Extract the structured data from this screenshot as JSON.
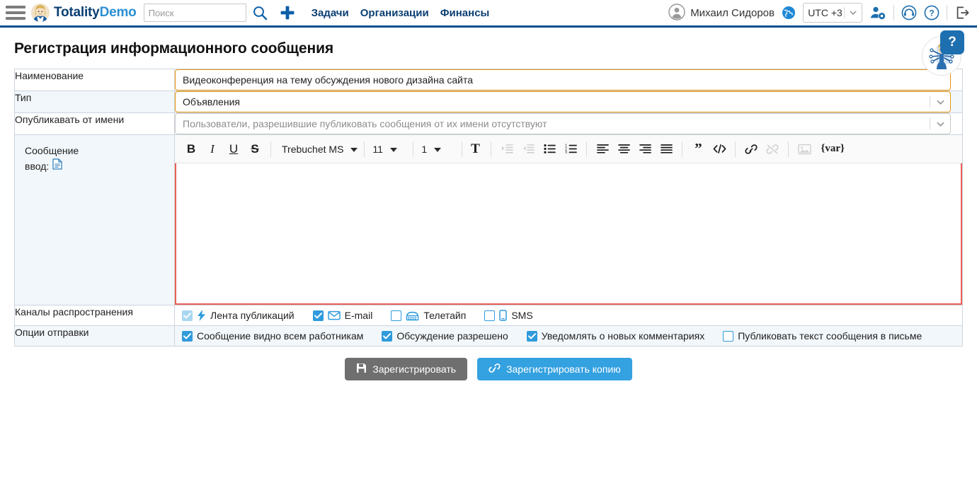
{
  "header": {
    "menu_icon": "hamburger-icon",
    "brand": {
      "part1": "Totality",
      "part2": "Demo"
    },
    "search": {
      "value": "",
      "placeholder": "Поиск"
    },
    "search_icon": "search-icon",
    "add_icon": "plus-icon",
    "nav": [
      {
        "label": "Задачи"
      },
      {
        "label": "Организации"
      },
      {
        "label": "Финансы"
      }
    ],
    "user": {
      "name": "Михаил Сидоров",
      "avatar_icon": "user-avatar-icon"
    },
    "globe_icon": "globe-icon",
    "timezone": {
      "value": "UTC +3"
    },
    "user_settings_icon": "user-settings-icon",
    "support_icon": "headset-icon",
    "help_icon": "question-circle-icon",
    "logout_icon": "logout-icon"
  },
  "page": {
    "title": "Регистрация информационного сообщения"
  },
  "helper": {
    "badge": "?",
    "avatar_icon": "assistant-avatar-icon"
  },
  "form": {
    "name": {
      "label": "Наименование",
      "value": "Видеоконференция на тему обсуждения нового дизайна сайта"
    },
    "type": {
      "label": "Тип",
      "value": "Объявления"
    },
    "publish_as": {
      "label": "Опубликавать от имени",
      "placeholder": "Пользователи, разрешившие публиковать сообщения от их имени отсутствуют",
      "value": ""
    },
    "message": {
      "label": "Сообщение",
      "input_label": "ввод:",
      "input_icon": "document-icon",
      "body": ""
    },
    "channels": {
      "label": "Каналы распространения"
    },
    "options": {
      "label": "Опции отправки"
    }
  },
  "editor": {
    "bold": "B",
    "italic": "I",
    "underline": "U",
    "strike": "S",
    "font": {
      "value": "Trebuchet MS"
    },
    "size": {
      "value": "11"
    },
    "lineheight": {
      "value": "1"
    },
    "textcolor": "T",
    "var_button": "{var}",
    "icons": [
      "bold-icon",
      "italic-icon",
      "underline-icon",
      "strikethrough-icon",
      "font-family-select",
      "font-size-select",
      "line-height-select",
      "text-color-icon",
      "indent-increase-icon",
      "indent-decrease-icon",
      "bullet-list-icon",
      "numbered-list-icon",
      "align-left-icon",
      "align-center-icon",
      "align-right-icon",
      "align-justify-icon",
      "blockquote-icon",
      "code-icon",
      "link-icon",
      "unlink-icon",
      "image-icon",
      "variable-button"
    ]
  },
  "channels": [
    {
      "label": "Лента публикаций",
      "checked": true,
      "disabled": true,
      "icon": "lightning-icon"
    },
    {
      "label": "E-mail",
      "checked": true,
      "disabled": false,
      "icon": "envelope-icon"
    },
    {
      "label": "Телетайп",
      "checked": false,
      "disabled": false,
      "icon": "teletype-icon"
    },
    {
      "label": "SMS",
      "checked": false,
      "disabled": false,
      "icon": "phone-icon"
    }
  ],
  "options": [
    {
      "label": "Сообщение видно всем работникам",
      "checked": true
    },
    {
      "label": "Обсуждение разрешено",
      "checked": true
    },
    {
      "label": "Уведомлять о новых комментариях",
      "checked": true
    },
    {
      "label": "Публиковать текст сообщения в письме",
      "checked": false
    }
  ],
  "actions": {
    "register": {
      "label": "Зарегистрировать",
      "icon": "save-icon"
    },
    "register_copy": {
      "label": "Зарегистрировать копию",
      "icon": "link-icon"
    }
  },
  "colors": {
    "brand_dark": "#0b3f73",
    "brand_light": "#2a8fd4",
    "header_rule": "#00508f",
    "focus_orange": "#e8960f",
    "editor_red": "#ed5d54",
    "checkbox_blue": "#2f9bdc",
    "button_gray": "#6f6f6f",
    "button_blue": "#34a1e0",
    "row_alt": "#f2f7fb"
  }
}
